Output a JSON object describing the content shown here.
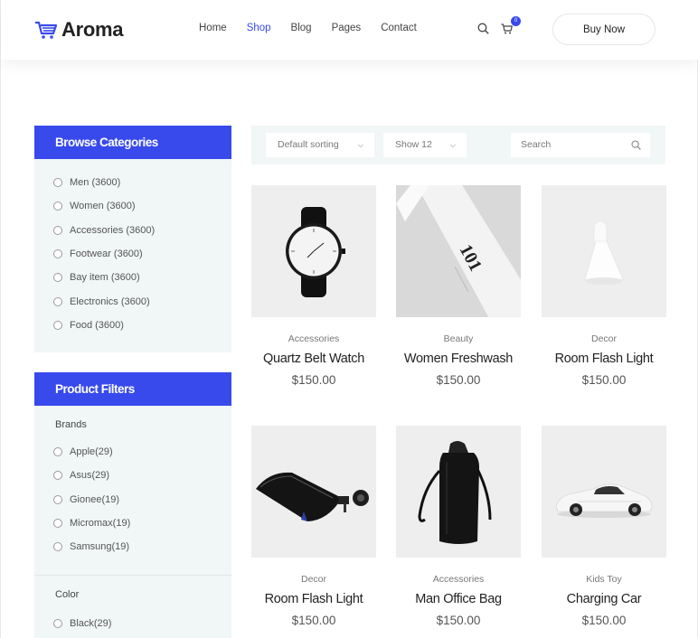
{
  "brand": {
    "name": "Aroma"
  },
  "nav": {
    "items": [
      {
        "label": "Home",
        "active": false
      },
      {
        "label": "Shop",
        "active": true
      },
      {
        "label": "Blog",
        "active": false
      },
      {
        "label": "Pages",
        "active": false
      },
      {
        "label": "Contact",
        "active": false
      }
    ],
    "cart_count": "0",
    "buy_label": "Buy Now"
  },
  "colors": {
    "accent": "#384aeb",
    "panel": "#f1f6f7"
  },
  "categories": {
    "title": "Browse Categories",
    "items": [
      {
        "label": "Men (3600)"
      },
      {
        "label": "Women (3600)"
      },
      {
        "label": "Accessories (3600)"
      },
      {
        "label": "Footwear (3600)"
      },
      {
        "label": "Bay item (3600)"
      },
      {
        "label": "Electronics (3600)"
      },
      {
        "label": "Food (3600)"
      }
    ]
  },
  "filters": {
    "title": "Product Filters",
    "brands_label": "Brands",
    "brands": [
      {
        "label": "Apple(29)"
      },
      {
        "label": "Asus(29)"
      },
      {
        "label": "Gionee(19)"
      },
      {
        "label": "Micromax(19)"
      },
      {
        "label": "Samsung(19)"
      }
    ],
    "color_label": "Color",
    "colors": [
      {
        "label": "Black(29)"
      }
    ]
  },
  "toolbar": {
    "sort": "Default sorting",
    "show": "Show 12",
    "search_placeholder": "Search"
  },
  "products": [
    {
      "category": "Accessories",
      "name": "Quartz Belt Watch",
      "price": "$150.00",
      "icon": "watch-image"
    },
    {
      "category": "Beauty",
      "name": "Women Freshwash",
      "price": "$150.00",
      "icon": "tube-image"
    },
    {
      "category": "Decor",
      "name": "Room Flash Light",
      "price": "$150.00",
      "icon": "lamp-image"
    },
    {
      "category": "Decor",
      "name": "Room Flash Light",
      "price": "$150.00",
      "icon": "pouch-image"
    },
    {
      "category": "Accessories",
      "name": "Man Office Bag",
      "price": "$150.00",
      "icon": "bag-image"
    },
    {
      "category": "Kids Toy",
      "name": "Charging Car",
      "price": "$150.00",
      "icon": "car-image"
    }
  ]
}
